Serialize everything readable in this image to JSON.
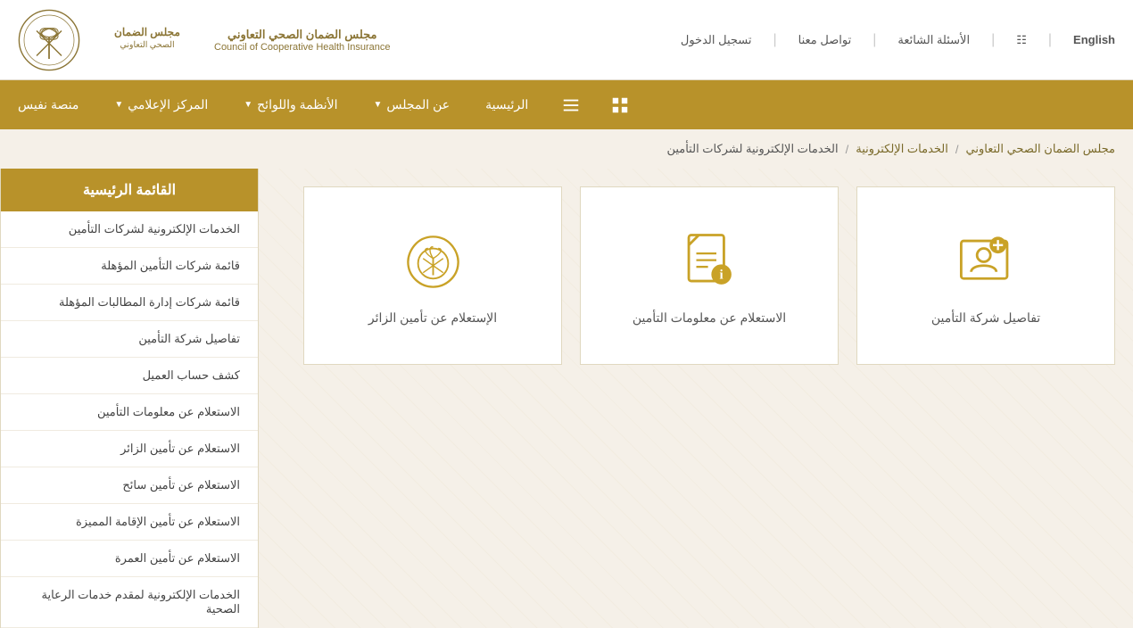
{
  "header": {
    "english_label": "English",
    "nav_links": [
      {
        "label": "تسجيل الدخول",
        "name": "login"
      },
      {
        "label": "تواصل معنا",
        "name": "contact"
      },
      {
        "label": "الأسئلة الشائعة",
        "name": "faq"
      }
    ],
    "logo_english": "Council of Cooperative Health Insurance",
    "logo_arabic": "مجلس الضمان الصحي التعاوني"
  },
  "main_nav": {
    "items": [
      {
        "label": "الرئيسية",
        "has_arrow": false,
        "name": "home"
      },
      {
        "label": "عن المجلس",
        "has_arrow": true,
        "name": "about"
      },
      {
        "label": "الأنظمة واللوائح",
        "has_arrow": true,
        "name": "regulations"
      },
      {
        "label": "المركز الإعلامي",
        "has_arrow": true,
        "name": "media"
      },
      {
        "label": "منصة نفيس",
        "has_arrow": false,
        "name": "nafees"
      }
    ]
  },
  "breadcrumb": {
    "items": [
      {
        "label": "مجلس الضمان الصحي التعاوني",
        "name": "home-bc"
      },
      {
        "label": "الخدمات الإلكترونية",
        "name": "eservices-bc"
      },
      {
        "label": "الخدمات الإلكترونية لشركات التأمين",
        "name": "insurance-eservices-bc"
      }
    ],
    "separator": "/"
  },
  "sidebar": {
    "title": "القائمة الرئيسية",
    "items": [
      {
        "label": "الخدمات الإلكترونية لشركات التأمين",
        "name": "sidebar-item-1"
      },
      {
        "label": "قائمة شركات التأمين المؤهلة",
        "name": "sidebar-item-2"
      },
      {
        "label": "قائمة شركات إدارة المطالبات المؤهلة",
        "name": "sidebar-item-3"
      },
      {
        "label": "تفاصيل شركة التأمين",
        "name": "sidebar-item-4"
      },
      {
        "label": "كشف حساب العميل",
        "name": "sidebar-item-5"
      },
      {
        "label": "الاستعلام عن معلومات التأمين",
        "name": "sidebar-item-6"
      },
      {
        "label": "الاستعلام عن تأمين الزائر",
        "name": "sidebar-item-7"
      },
      {
        "label": "الاستعلام عن تأمين سائح",
        "name": "sidebar-item-8"
      },
      {
        "label": "الاستعلام عن تأمين الإقامة المميزة",
        "name": "sidebar-item-9"
      },
      {
        "label": "الاستعلام عن تأمين العمرة",
        "name": "sidebar-item-10"
      },
      {
        "label": "الخدمات الإلكترونية لمقدم خدمات الرعاية الصحية",
        "name": "sidebar-item-11"
      }
    ]
  },
  "service_cards": [
    {
      "label": "تفاصيل شركة التأمين",
      "name": "card-insurance-details",
      "icon": "person-card"
    },
    {
      "label": "الاستعلام عن معلومات التأمين",
      "name": "card-insurance-info",
      "icon": "document-info"
    },
    {
      "label": "الإستعلام عن تأمين الزائر",
      "name": "card-visitor-insurance",
      "icon": "emblem"
    }
  ]
}
